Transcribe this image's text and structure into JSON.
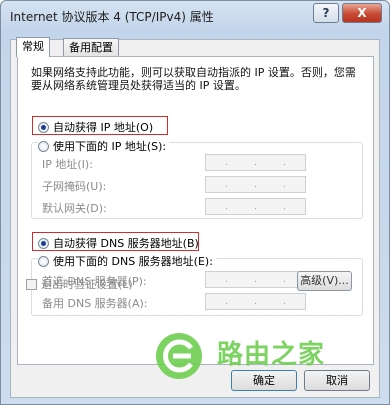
{
  "window": {
    "title": "Internet 协议版本 4 (TCP/IPv4) 属性",
    "help_label": "?",
    "close_label": "X"
  },
  "tabs": [
    {
      "label": "常规",
      "active": true
    },
    {
      "label": "备用配置",
      "active": false
    }
  ],
  "description": "如果网络支持此功能，则可以获取自动指派的 IP 设置。否则，您需要从网络系统管理员处获得适当的 IP 设置。",
  "ip_section": {
    "auto_label": "自动获得 IP 地址(O)",
    "manual_label": "使用下面的 IP 地址(S):",
    "selected": "auto",
    "fields": [
      {
        "label": "IP 地址(I):"
      },
      {
        "label": "子网掩码(U):"
      },
      {
        "label": "默认网关(D):"
      }
    ]
  },
  "dns_section": {
    "auto_label": "自动获得 DNS 服务器地址(B)",
    "manual_label": "使用下面的 DNS 服务器地址(E):",
    "selected": "auto",
    "fields": [
      {
        "label": "首选 DNS 服务器(P):"
      },
      {
        "label": "备用 DNS 服务器(A):"
      }
    ]
  },
  "validate_label": "退出时验证设置(L)",
  "advanced_label": "高级(V)...",
  "ok_label": "确定",
  "cancel_label": "取消",
  "watermark": {
    "text": "路由之家",
    "color": "#6fcf50"
  }
}
